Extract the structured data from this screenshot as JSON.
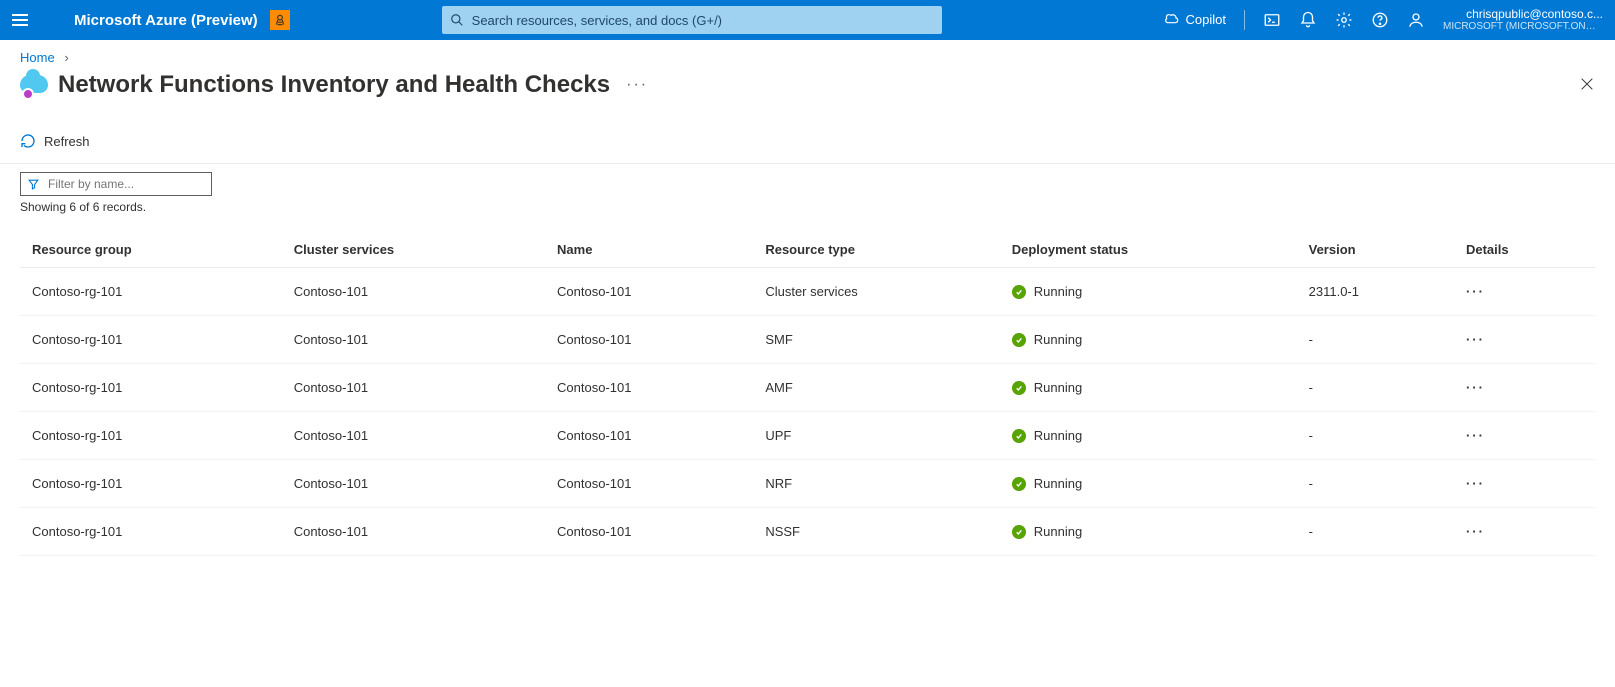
{
  "topbar": {
    "brand": "Microsoft Azure (Preview)",
    "search_placeholder": "Search resources, services, and docs (G+/)",
    "copilot_label": "Copilot",
    "account_email": "chrisqpublic@contoso.c...",
    "account_directory": "MICROSOFT (MICROSOFT.ONMI..."
  },
  "breadcrumb": {
    "home": "Home"
  },
  "page": {
    "title": "Network Functions Inventory and Health Checks",
    "more": "···"
  },
  "commands": {
    "refresh": "Refresh"
  },
  "filter": {
    "placeholder": "Filter by name...",
    "records_text": "Showing 6 of 6 records."
  },
  "table": {
    "headers": {
      "resource_group": "Resource group",
      "cluster_services": "Cluster services",
      "name": "Name",
      "resource_type": "Resource type",
      "deployment_status": "Deployment status",
      "version": "Version",
      "details": "Details"
    },
    "rows": [
      {
        "rg": "Contoso-rg-101",
        "cs": "Contoso-101",
        "name": "Contoso-101",
        "rt": "Cluster services",
        "status": "Running",
        "version": "2311.0-1"
      },
      {
        "rg": "Contoso-rg-101",
        "cs": "Contoso-101",
        "name": "Contoso-101",
        "rt": "SMF",
        "status": "Running",
        "version": "-"
      },
      {
        "rg": "Contoso-rg-101",
        "cs": "Contoso-101",
        "name": "Contoso-101",
        "rt": "AMF",
        "status": "Running",
        "version": "-"
      },
      {
        "rg": "Contoso-rg-101",
        "cs": "Contoso-101",
        "name": "Contoso-101",
        "rt": "UPF",
        "status": "Running",
        "version": "-"
      },
      {
        "rg": "Contoso-rg-101",
        "cs": "Contoso-101",
        "name": "Contoso-101",
        "rt": "NRF",
        "status": "Running",
        "version": "-"
      },
      {
        "rg": "Contoso-rg-101",
        "cs": "Contoso-101",
        "name": "Contoso-101",
        "rt": "NSSF",
        "status": "Running",
        "version": "-"
      }
    ]
  }
}
